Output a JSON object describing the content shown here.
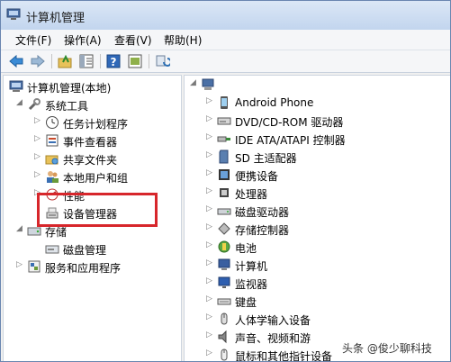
{
  "window": {
    "title": "计算机管理"
  },
  "menubar": [
    "文件(F)",
    "操作(A)",
    "查看(V)",
    "帮助(H)"
  ],
  "toolbar": [
    "back-icon",
    "forward-icon",
    "up-folder-icon",
    "show-hide-tree-icon",
    "help-icon",
    "details-icon",
    "refresh-icon"
  ],
  "left_tree": [
    {
      "label": "计算机管理(本地)",
      "icon": "computer-management-icon",
      "level": 0,
      "toggle": ""
    },
    {
      "label": "系统工具",
      "icon": "system-tools-icon",
      "level": 1,
      "toggle": "◢"
    },
    {
      "label": "任务计划程序",
      "icon": "clock-icon",
      "level": 2,
      "toggle": "▷"
    },
    {
      "label": "事件查看器",
      "icon": "event-viewer-icon",
      "level": 2,
      "toggle": "▷"
    },
    {
      "label": "共享文件夹",
      "icon": "shared-folder-icon",
      "level": 2,
      "toggle": "▷"
    },
    {
      "label": "本地用户和组",
      "icon": "users-icon",
      "level": 2,
      "toggle": "▷"
    },
    {
      "label": "性能",
      "icon": "performance-icon",
      "level": 2,
      "toggle": "▷"
    },
    {
      "label": "设备管理器",
      "icon": "device-manager-icon",
      "level": 2,
      "toggle": ""
    },
    {
      "label": "存储",
      "icon": "storage-icon",
      "level": 1,
      "toggle": "◢"
    },
    {
      "label": "磁盘管理",
      "icon": "disk-icon",
      "level": 2,
      "toggle": ""
    },
    {
      "label": "服务和应用程序",
      "icon": "services-icon",
      "level": 1,
      "toggle": "▷"
    }
  ],
  "right_tree": [
    {
      "label": "",
      "icon": "computer-icon",
      "toggle": "◢",
      "root": true
    },
    {
      "label": "Android Phone",
      "icon": "phone-icon",
      "toggle": "▷"
    },
    {
      "label": "DVD/CD-ROM 驱动器",
      "icon": "cdrom-icon",
      "toggle": "▷"
    },
    {
      "label": "IDE ATA/ATAPI 控制器",
      "icon": "ide-icon",
      "toggle": "▷"
    },
    {
      "label": "SD 主适配器",
      "icon": "sd-card-icon",
      "toggle": "▷"
    },
    {
      "label": "便携设备",
      "icon": "portable-device-icon",
      "toggle": "▷"
    },
    {
      "label": "处理器",
      "icon": "processor-icon",
      "toggle": "▷"
    },
    {
      "label": "磁盘驱动器",
      "icon": "disk-drive-icon",
      "toggle": "▷"
    },
    {
      "label": "存储控制器",
      "icon": "storage-controller-icon",
      "toggle": "▷"
    },
    {
      "label": "电池",
      "icon": "battery-icon",
      "toggle": "▷"
    },
    {
      "label": "计算机",
      "icon": "computer-icon",
      "toggle": "▷"
    },
    {
      "label": "监视器",
      "icon": "monitor-icon",
      "toggle": "▷"
    },
    {
      "label": "键盘",
      "icon": "keyboard-icon",
      "toggle": "▷"
    },
    {
      "label": "人体学输入设备",
      "icon": "hid-icon",
      "toggle": "▷"
    },
    {
      "label": "声音、视频和游",
      "icon": "sound-icon",
      "toggle": "▷"
    },
    {
      "label": "鼠标和其他指针设备",
      "icon": "mouse-icon",
      "toggle": "▷"
    }
  ],
  "watermark": "头条 @俊少聊科技",
  "colors": {
    "highlight": "#d7262b",
    "titlebar": "#c2d5ee"
  }
}
